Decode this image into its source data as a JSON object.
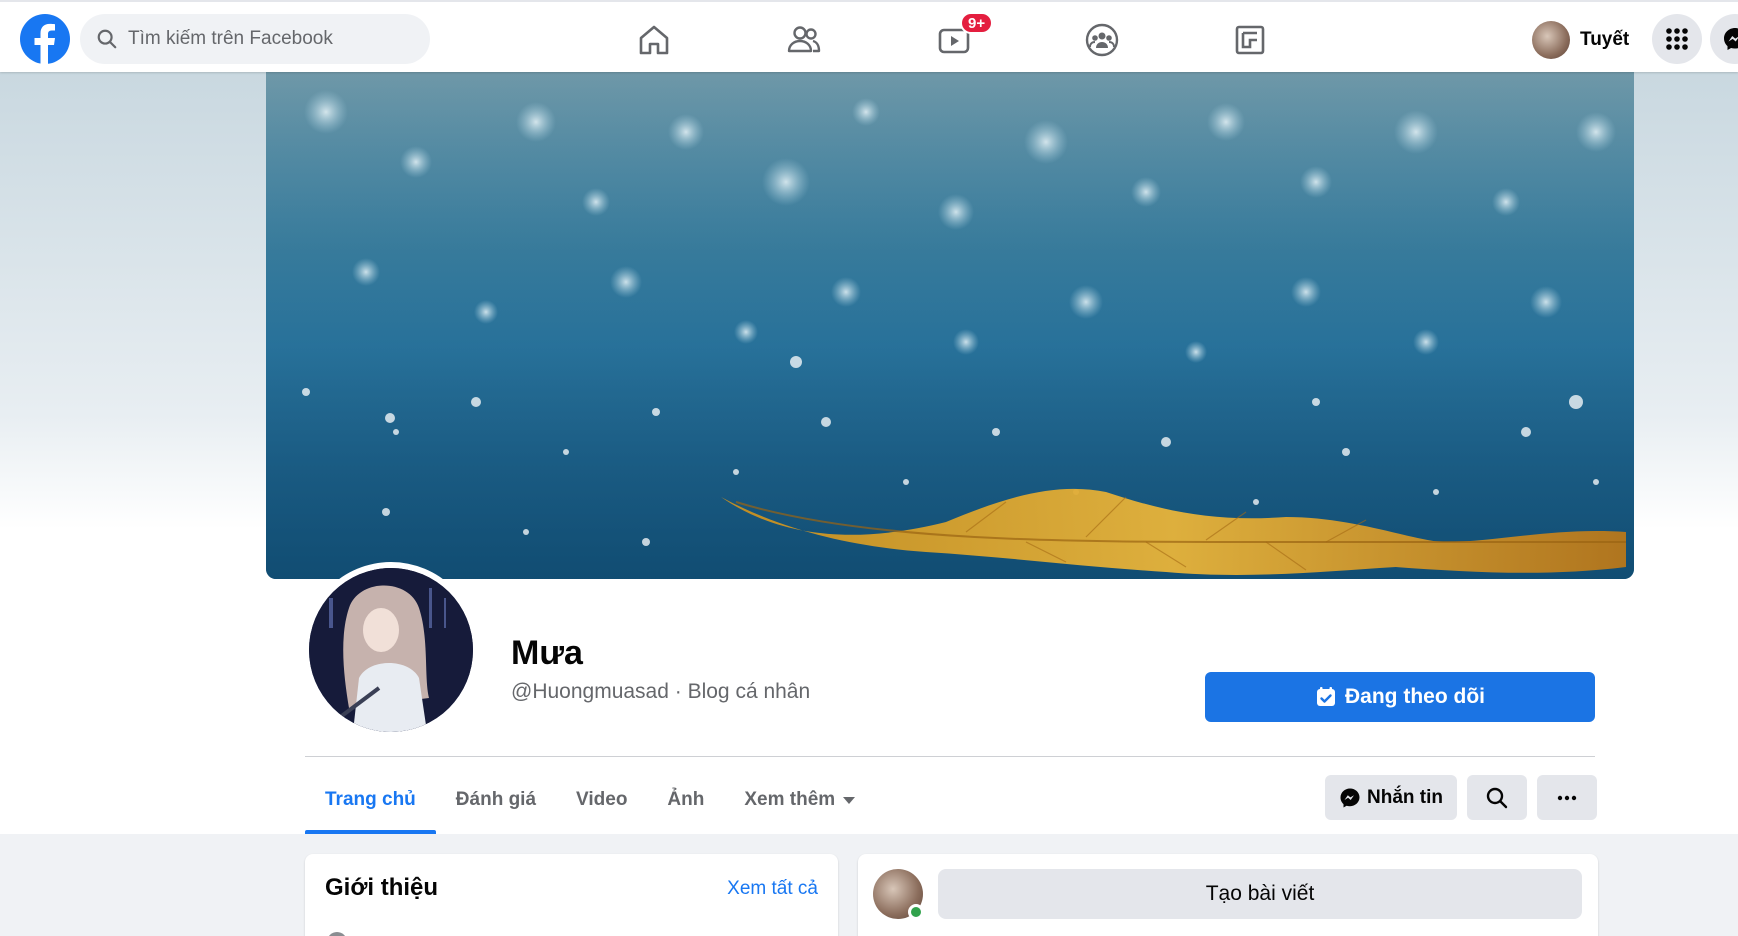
{
  "topbar": {
    "search_placeholder": "Tìm kiếm trên Facebook",
    "watch_badge": "9+",
    "user_name": "Tuyết",
    "nav_icons": [
      "home-icon",
      "friends-icon",
      "watch-icon",
      "groups-icon",
      "gaming-icon"
    ]
  },
  "page": {
    "name": "Mưa",
    "subtitle": "@Huongmuasad · Blog cá nhân",
    "follow_label": "Đang theo dõi"
  },
  "tabs": [
    {
      "label": "Trang chủ",
      "active": true
    },
    {
      "label": "Đánh giá"
    },
    {
      "label": "Video"
    },
    {
      "label": "Ảnh"
    },
    {
      "label": "Xem thêm"
    }
  ],
  "actions": {
    "message_label": "Nhắn tin"
  },
  "intro": {
    "title": "Giới thiệu",
    "see_all": "Xem tất cả"
  },
  "composer": {
    "label": "Tạo bài viết"
  },
  "colors": {
    "brand": "#1877f2",
    "follow_button": "#1b74e4",
    "badge": "#e41e3f",
    "online": "#31a24c"
  }
}
